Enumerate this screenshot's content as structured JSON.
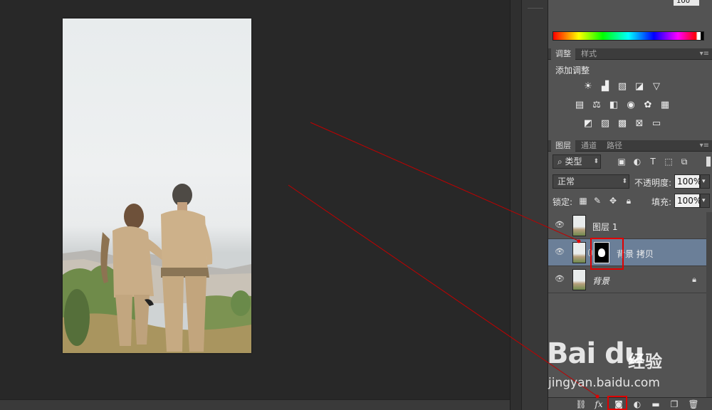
{
  "color_panel": {
    "value_field": "100"
  },
  "adjustments": {
    "tabs": [
      "调整",
      "样式"
    ],
    "title": "添加调整"
  },
  "layers_panel": {
    "tabs": [
      "图层",
      "通道",
      "路径"
    ],
    "filter_kind": "类型",
    "blend_mode": "正常",
    "opacity_label": "不透明度:",
    "opacity_value": "100%",
    "lock_label": "锁定:",
    "fill_label": "填充:",
    "fill_value": "100%",
    "layers": [
      {
        "name": "图层 1",
        "selected": false,
        "has_mask": false,
        "locked": false
      },
      {
        "name": "背景 拷贝",
        "selected": true,
        "has_mask": true,
        "locked": false
      },
      {
        "name": "背景",
        "selected": false,
        "has_mask": false,
        "locked": true
      }
    ]
  },
  "bottom_icons": [
    "link-icon",
    "fx-icon",
    "add-mask-icon",
    "adjustment-layer-icon",
    "group-folder-icon",
    "new-layer-icon",
    "trash-icon"
  ],
  "fx_label": "fx",
  "watermark": {
    "logo": "Bai du",
    "cn": "经验",
    "url": "jingyan.baidu.com"
  },
  "colors": {
    "annotation_red": "#e00000",
    "selection_blue": "#6b7f98"
  }
}
